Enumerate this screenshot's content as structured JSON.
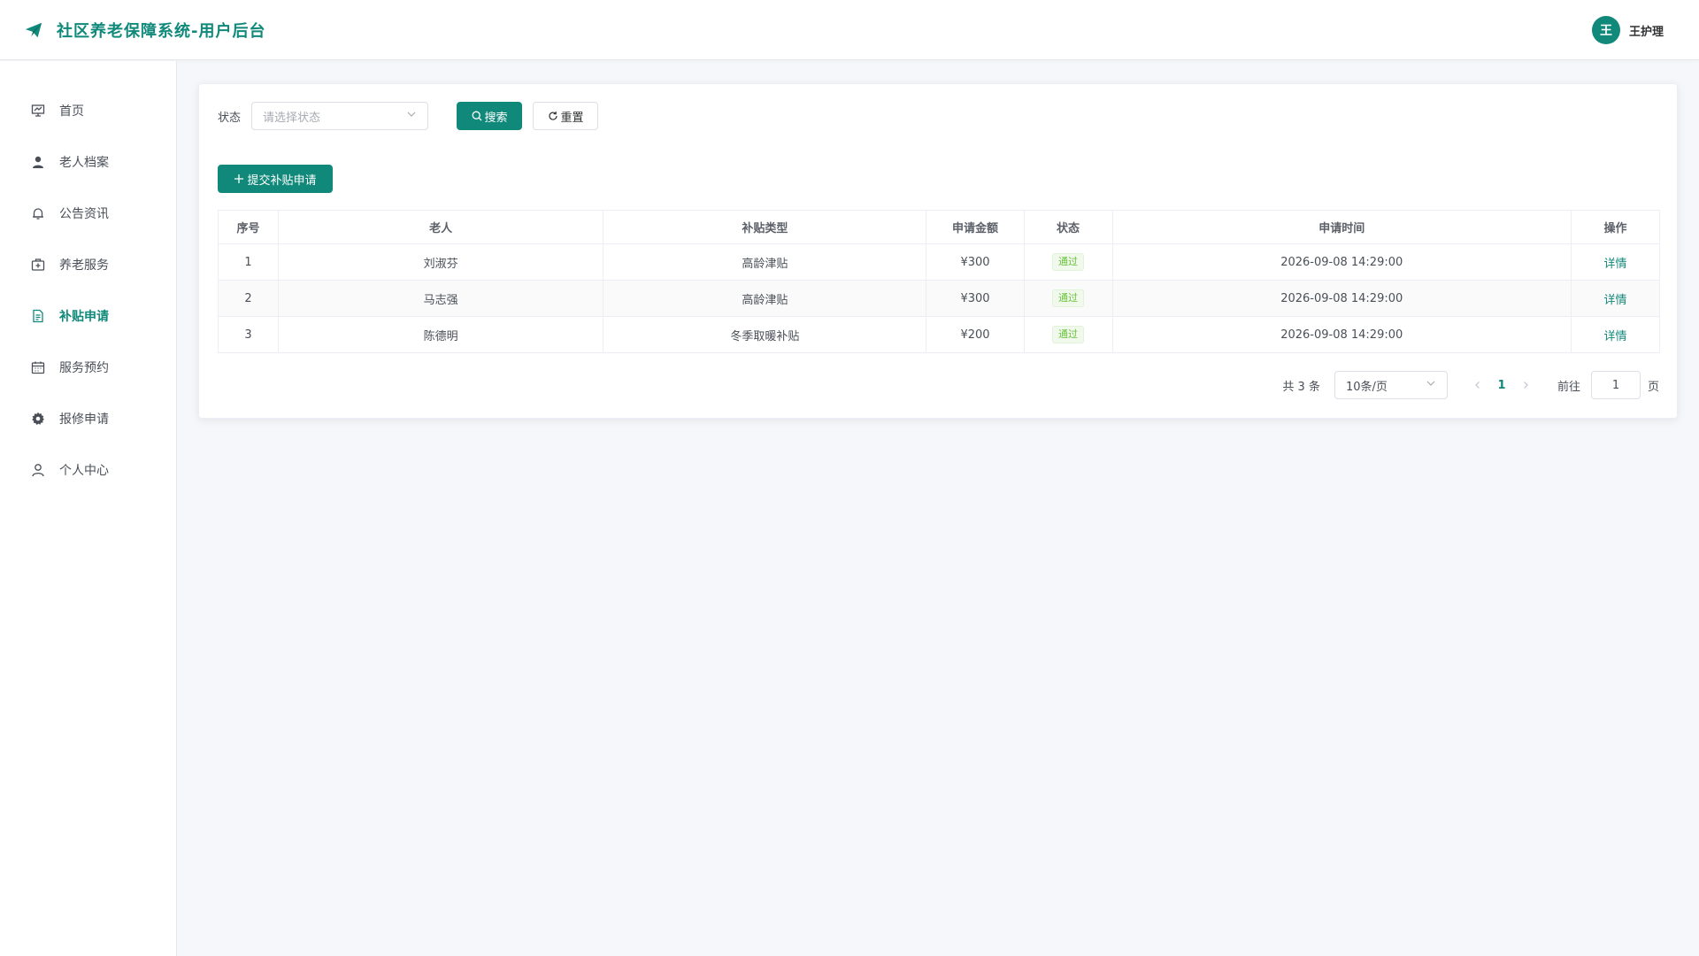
{
  "app": {
    "title": "社区养老保障系统-用户后台",
    "accent_color": "#11897a",
    "logo_icon": "paper-plane-icon"
  },
  "user": {
    "avatar_text": "王",
    "name": "王护理"
  },
  "sidebar": {
    "items": [
      {
        "label": "首页",
        "icon": "presentation-icon",
        "active": false
      },
      {
        "label": "老人档案",
        "icon": "user-icon",
        "active": false
      },
      {
        "label": "公告资讯",
        "icon": "bell-icon",
        "active": false
      },
      {
        "label": "养老服务",
        "icon": "first-aid-kit-icon",
        "active": false
      },
      {
        "label": "补贴申请",
        "icon": "document-icon",
        "active": true
      },
      {
        "label": "服务预约",
        "icon": "calendar-icon",
        "active": false
      },
      {
        "label": "报修申请",
        "icon": "gear-icon",
        "active": false
      },
      {
        "label": "个人中心",
        "icon": "user-outline-icon",
        "active": false
      }
    ]
  },
  "filter": {
    "status_label": "状态",
    "status_placeholder": "请选择状态",
    "search_label": "搜索",
    "reset_label": "重置"
  },
  "actions": {
    "add_label": "提交补贴申请"
  },
  "table": {
    "headers": [
      "序号",
      "老人",
      "补贴类型",
      "申请金额",
      "状态",
      "申请时间",
      "操作"
    ],
    "rows": [
      {
        "index": "1",
        "elder": "刘淑芬",
        "type": "高龄津贴",
        "amount": "¥300",
        "status": "通过",
        "time": "2026-09-08 14:29:00",
        "action": "详情"
      },
      {
        "index": "2",
        "elder": "马志强",
        "type": "高龄津贴",
        "amount": "¥300",
        "status": "通过",
        "time": "2026-09-08 14:29:00",
        "action": "详情"
      },
      {
        "index": "3",
        "elder": "陈德明",
        "type": "冬季取暖补贴",
        "amount": "¥200",
        "status": "通过",
        "time": "2026-09-08 14:29:00",
        "action": "详情"
      }
    ]
  },
  "pagination": {
    "total_text": "共 3 条",
    "page_size": "10条/页",
    "current_page": "1",
    "goto_label": "前往",
    "goto_value": "1",
    "page_suffix": "页"
  }
}
